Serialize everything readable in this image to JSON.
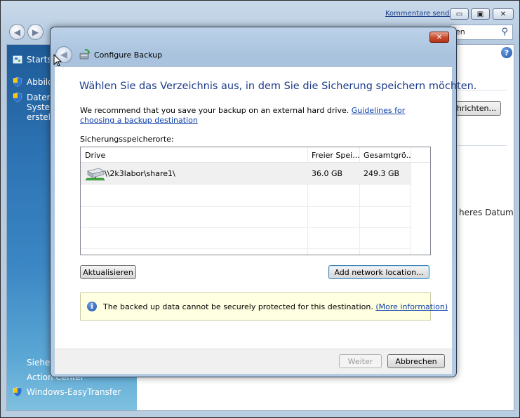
{
  "background": {
    "feedback_link": "Kommentare senden",
    "search_text": "en",
    "sidebar": {
      "start": "Startsei",
      "images": "Abbilds",
      "data_lines": [
        "Datentr",
        "System",
        "erstelle"
      ],
      "see_also": "Siehe a",
      "action_center": "Action Center",
      "easy_transfer": "Windows-EasyTransfer"
    },
    "right_button": "hrichten...",
    "right_text": "heres Datum"
  },
  "dialog": {
    "title": "Configure Backup",
    "heading": "Wählen Sie das Verzeichnis aus, in dem Sie die Sicherung speichern möchten.",
    "recommendation_text": "We recommend that you save your backup on an external hard drive.",
    "guidelines_link": "Guidelines for choosing a backup destination",
    "locations_label": "Sicherungsspeicherorte:",
    "table": {
      "columns": [
        "Drive",
        "Freier Spei...",
        "Gesamtgrö..."
      ],
      "rows": [
        {
          "name": "\\\\2k3labor\\share1\\",
          "free": "36.0 GB",
          "total": "249.3 GB"
        }
      ]
    },
    "refresh_button": "Aktualisieren",
    "add_network_button": "Add network location...",
    "info_text": "The backed up data cannot be securely protected for this destination.",
    "info_link": "(More information)",
    "next_button": "Weiter",
    "cancel_button": "Abbrechen"
  },
  "icons": {
    "close": "close-icon",
    "back": "back-arrow-icon",
    "info": "info-icon",
    "network_drive": "network-drive-icon",
    "shield": "shield-icon"
  },
  "colors": {
    "heading_blue": "#1e3c8c",
    "link_blue": "#0b3ea8",
    "info_background": "#ffffe1",
    "close_red": "#c94a2f"
  }
}
